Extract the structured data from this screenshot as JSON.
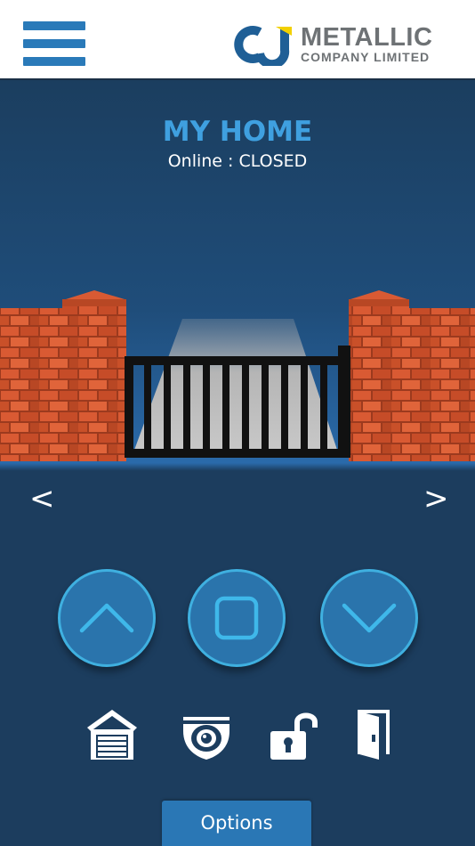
{
  "header": {
    "logo_line1": "METALLIC",
    "logo_line2": "COMPANY LIMITED",
    "logo_mark": "CJ"
  },
  "device": {
    "name": "MY HOME",
    "status": "Online : CLOSED"
  },
  "nav": {
    "prev": "<",
    "next": ">"
  },
  "controls": [
    {
      "icon": "chevron-up-icon"
    },
    {
      "icon": "stop-icon"
    },
    {
      "icon": "chevron-down-icon"
    }
  ],
  "tools": [
    {
      "icon": "garage-icon"
    },
    {
      "icon": "camera-icon"
    },
    {
      "icon": "unlock-icon"
    },
    {
      "icon": "door-icon"
    }
  ],
  "footer": {
    "options_label": "Options"
  },
  "colors": {
    "accent": "#3fa0e0",
    "brand_blue": "#2a7ab9",
    "background": "#1c3d5e",
    "brick": "#c8502e",
    "logo_yellow": "#f2d000"
  }
}
